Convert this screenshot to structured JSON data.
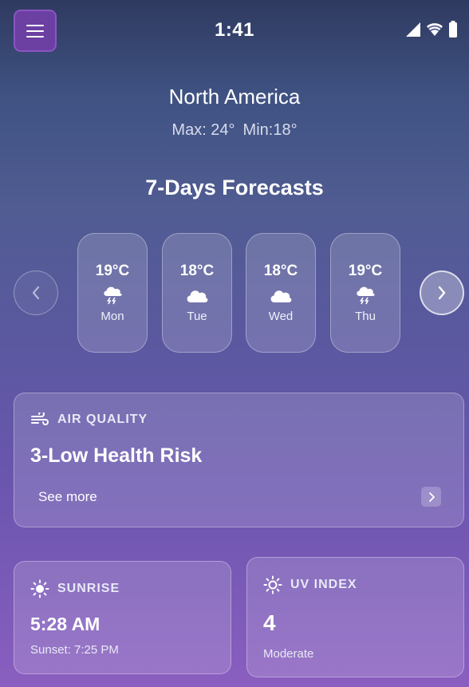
{
  "status_bar": {
    "time": "1:41"
  },
  "location": {
    "name": "North America",
    "max": "Max: 24°",
    "min": "Min:18°"
  },
  "forecast": {
    "title": "7-Days Forecasts",
    "days": [
      {
        "temp": "19°C",
        "day": "Mon",
        "icon": "thunderstorm-icon"
      },
      {
        "temp": "18°C",
        "day": "Tue",
        "icon": "cloud-icon"
      },
      {
        "temp": "18°C",
        "day": "Wed",
        "icon": "cloud-icon"
      },
      {
        "temp": "19°C",
        "day": "Thu",
        "icon": "thunderstorm-icon"
      }
    ]
  },
  "air_quality": {
    "label": "AIR QUALITY",
    "value": "3-Low Health Risk",
    "link": "See more"
  },
  "sunrise": {
    "label": "SUNRISE",
    "value": "5:28 AM",
    "sub": "Sunset: 7:25 PM"
  },
  "uv_index": {
    "label": "UV INDEX",
    "value": "4",
    "sub": "Moderate"
  },
  "colors": {
    "menu_button": "#6c3fa2",
    "accent_border": "#8b55c3"
  }
}
